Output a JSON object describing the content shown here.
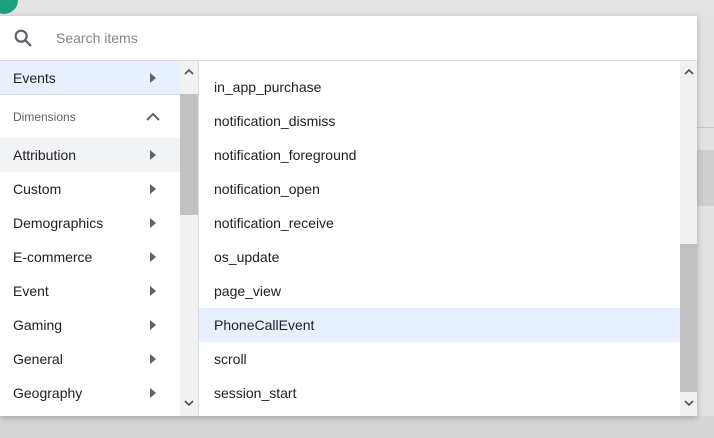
{
  "search": {
    "placeholder": "Search items",
    "value": ""
  },
  "left_menu": {
    "top_item": {
      "label": "Events",
      "icon": "chevron-right-icon"
    },
    "section": {
      "label": "Dimensions",
      "icon": "chevron-up-icon"
    },
    "items": [
      {
        "label": "Attribution"
      },
      {
        "label": "Custom"
      },
      {
        "label": "Demographics"
      },
      {
        "label": "E-commerce"
      },
      {
        "label": "Event"
      },
      {
        "label": "Gaming"
      },
      {
        "label": "General"
      },
      {
        "label": "Geography"
      }
    ]
  },
  "right_list": {
    "items": [
      "in_app_purchase",
      "notification_dismiss",
      "notification_foreground",
      "notification_open",
      "notification_receive",
      "os_update",
      "page_view",
      "PhoneCallEvent",
      "scroll",
      "session_start"
    ],
    "selected": "PhoneCallEvent"
  },
  "colors": {
    "selected_bg": "#e8f0fe",
    "hover_bg": "#f1f3f4",
    "avatar": "#1aa27c"
  }
}
